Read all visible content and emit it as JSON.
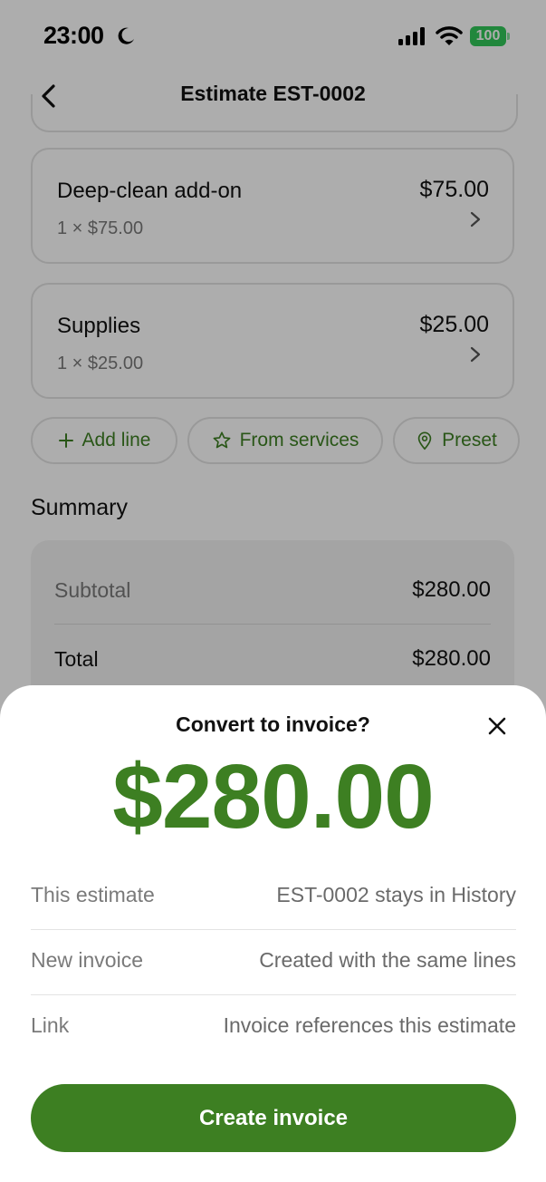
{
  "status_bar": {
    "time": "23:00",
    "battery": "100"
  },
  "nav": {
    "title": "Estimate EST-0002"
  },
  "lines": [
    {
      "name": "Deep-clean add-on",
      "detail": "1 × $75.00",
      "amount": "$75.00"
    },
    {
      "name": "Supplies",
      "detail": "1 × $25.00",
      "amount": "$25.00"
    }
  ],
  "actions": {
    "add_line": "Add line",
    "from_services": "From services",
    "preset": "Preset"
  },
  "summary": {
    "heading": "Summary",
    "subtotal_label": "Subtotal",
    "subtotal_value": "$280.00",
    "total_label": "Total",
    "total_value": "$280.00"
  },
  "sheet": {
    "title": "Convert to invoice?",
    "amount": "$280.00",
    "rows": [
      {
        "label": "This estimate",
        "value": "EST-0002 stays in History"
      },
      {
        "label": "New invoice",
        "value": "Created with the same lines"
      },
      {
        "label": "Link",
        "value": "Invoice references this estimate"
      }
    ],
    "create_button": "Create invoice"
  },
  "colors": {
    "accent": "#3d7f22",
    "battery": "#32c759"
  },
  "icons": [
    "moon-icon",
    "signal-icon",
    "wifi-icon",
    "back-chevron-icon",
    "chevron-right-icon",
    "plus-icon",
    "star-icon",
    "location-pin-icon",
    "close-icon"
  ]
}
